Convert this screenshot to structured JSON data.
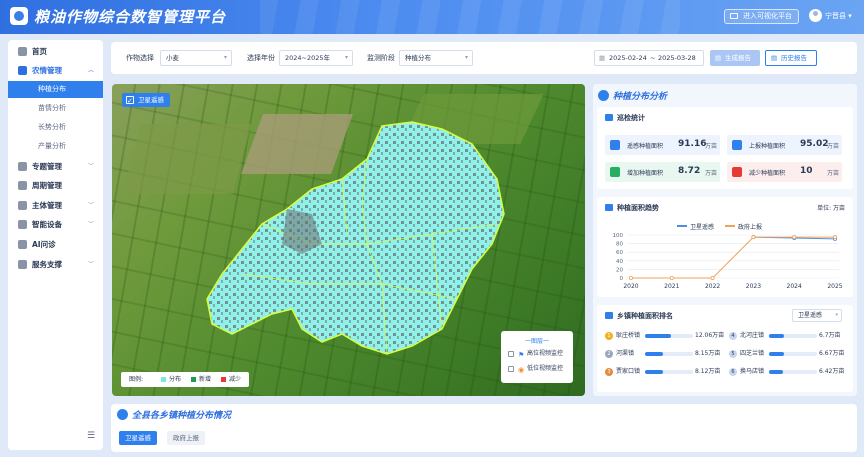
{
  "header": {
    "title": "粮油作物综合数智管理平台",
    "visual_platform_label": "进入可视化平台",
    "username": "宁晋县"
  },
  "sidebar": {
    "items": [
      {
        "label": "首页",
        "icon": "home-icon"
      },
      {
        "label": "农情管理",
        "icon": "crop-icon",
        "expanded": true,
        "children": [
          {
            "label": "种植分布",
            "active": true
          },
          {
            "label": "苗情分析"
          },
          {
            "label": "长势分析"
          },
          {
            "label": "产量分析"
          }
        ]
      },
      {
        "label": "专题管理",
        "icon": "topic-icon"
      },
      {
        "label": "周期管理",
        "icon": "cycle-icon"
      },
      {
        "label": "主体管理",
        "icon": "entity-icon"
      },
      {
        "label": "智能设备",
        "icon": "device-icon"
      },
      {
        "label": "AI问诊",
        "icon": "ai-icon"
      },
      {
        "label": "服务支撑",
        "icon": "service-icon"
      }
    ],
    "collapse_icon": "menu-fold-icon"
  },
  "filters": {
    "crop_label": "作物选择",
    "crop_value": "小麦",
    "year_label": "选择年份",
    "year_value": "2024~2025年",
    "stage_label": "监测阶段",
    "stage_value": "种植分布",
    "date_start": "2025-02-24",
    "date_sep": "~",
    "date_end": "2025-03-28",
    "generate_label": "生成报告",
    "history_label": "历史报告"
  },
  "map": {
    "layer_toggle_label": "卫星遥感",
    "legend_title": "图例:",
    "legend": [
      {
        "label": "分布",
        "color": "#7be8e0"
      },
      {
        "label": "新增",
        "color": "#1f9d55"
      },
      {
        "label": "减少",
        "color": "#e53935"
      }
    ],
    "monitor_title": "一图层一",
    "monitor_items": [
      {
        "label": "高位视频监控",
        "icon": "camera-icon"
      },
      {
        "label": "低位视频监控",
        "icon": "low-camera-icon"
      }
    ]
  },
  "right_panel": {
    "title": "种植分布分析",
    "inspection": {
      "title": "巡检统计",
      "stats": [
        {
          "label": "遥感种植面积",
          "value": "91.16",
          "unit": "万亩",
          "bg": "#eef4fe",
          "icon_color": "#2f80ed"
        },
        {
          "label": "上报种植面积",
          "value": "95.02",
          "unit": "万亩",
          "bg": "#eef4fe",
          "icon_color": "#2f80ed"
        },
        {
          "label": "增加种植面积",
          "value": "8.72",
          "unit": "万亩",
          "bg": "#e8f7f0",
          "icon_color": "#27ae60"
        },
        {
          "label": "减少种植面积",
          "value": "10",
          "unit": "万亩",
          "bg": "#fdeeee",
          "icon_color": "#e53935"
        }
      ]
    },
    "trend": {
      "title": "种植面积趋势",
      "unit": "单位: 万亩"
    },
    "ranking": {
      "title": "乡镇种植面积排名",
      "select_value": "卫星遥感",
      "rows": [
        {
          "rank": 1,
          "name": "耿庄桥镇",
          "value": 12.06,
          "value_label": "12.06万亩"
        },
        {
          "rank": 2,
          "name": "河渠镇",
          "value": 8.15,
          "value_label": "8.15万亩"
        },
        {
          "rank": 3,
          "name": "贾家口镇",
          "value": 8.12,
          "value_label": "8.12万亩"
        },
        {
          "rank": 4,
          "name": "北河庄镇",
          "value": 6.7,
          "value_label": "6.7万亩"
        },
        {
          "rank": 5,
          "name": "四芝兰镇",
          "value": 6.67,
          "value_label": "6.67万亩"
        },
        {
          "rank": 6,
          "name": "换马店镇",
          "value": 6.42,
          "value_label": "6.42万亩"
        }
      ]
    }
  },
  "bottom": {
    "title": "全县各乡镇种植分布情况",
    "tabs": [
      {
        "label": "卫星遥感",
        "active": true
      },
      {
        "label": "政府上报",
        "active": false
      }
    ]
  },
  "chart_data": {
    "type": "line",
    "x": [
      "2020",
      "2021",
      "2022",
      "2023",
      "2024",
      "2025"
    ],
    "series": [
      {
        "name": "卫星遥感",
        "color": "#4a90e2",
        "values": [
          null,
          null,
          null,
          95,
          93,
          91
        ]
      },
      {
        "name": "政府上报",
        "color": "#f0a15c",
        "values": [
          0,
          0,
          0,
          95,
          95,
          95
        ]
      }
    ],
    "ylim": [
      0,
      100
    ],
    "yticks": [
      0,
      20,
      40,
      60,
      80,
      100
    ],
    "grid": true,
    "legend": "top-center"
  }
}
